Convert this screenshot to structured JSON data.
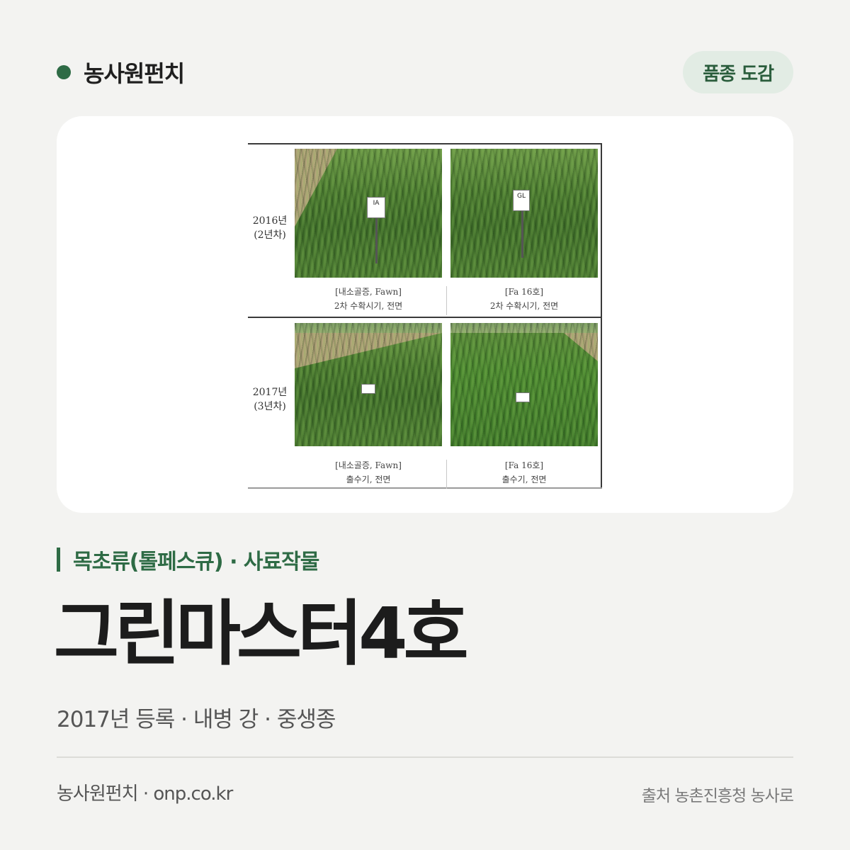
{
  "header": {
    "brand_name": "농사원펀치",
    "tag_label": "품종 도감"
  },
  "figure": {
    "rows": [
      {
        "year": "2016년",
        "stage": "(2년차)",
        "photos": [
          {
            "stake_label": "IA",
            "caption_line1": "[내소골증, Fawn]",
            "caption_line2": "2차 수확시기, 전면"
          },
          {
            "stake_label": "GL",
            "caption_line1": "[Fa 16호]",
            "caption_line2": "2차 수확시기, 전면"
          }
        ]
      },
      {
        "year": "2017년",
        "stage": "(3년차)",
        "photos": [
          {
            "stake_label": "",
            "caption_line1": "[내소골증, Fawn]",
            "caption_line2": "출수기, 전면"
          },
          {
            "stake_label": "",
            "caption_line1": "[Fa 16호]",
            "caption_line2": "출수기, 전면"
          }
        ]
      }
    ]
  },
  "category": {
    "text": "목초류(톨페스큐) · 사료작물"
  },
  "variety": {
    "title": "그린마스터4호",
    "meta": "2017년 등록 · 내병 강 · 중생종"
  },
  "footer": {
    "left": "농사원펀치 · onp.co.kr",
    "right": "출처 농촌진흥청 농사로"
  },
  "colors": {
    "accent": "#2e6b45",
    "pill_bg": "#e2ece4",
    "page_bg": "#f3f3f1"
  }
}
